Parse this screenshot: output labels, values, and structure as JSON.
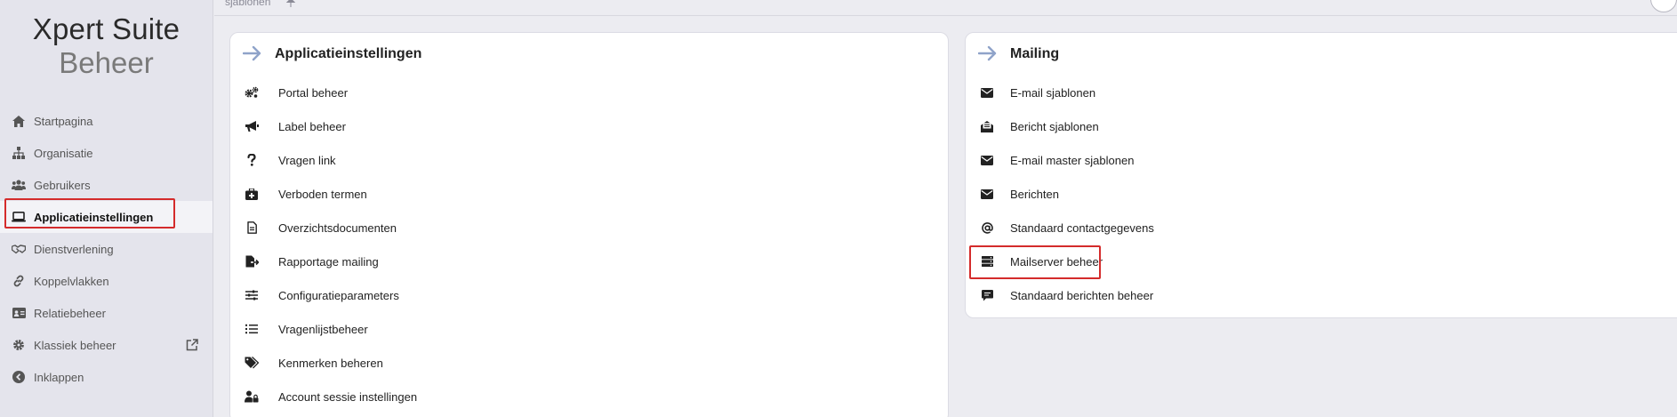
{
  "brand": {
    "line1": "Xpert Suite",
    "line2": "Beheer"
  },
  "breadcrumb": {
    "current": "sjablonen"
  },
  "sidebar": {
    "items": [
      {
        "label": "Startpagina",
        "icon": "home-icon"
      },
      {
        "label": "Organisatie",
        "icon": "sitemap-icon"
      },
      {
        "label": "Gebruikers",
        "icon": "users-icon"
      },
      {
        "label": "Applicatieinstellingen",
        "icon": "laptop-icon",
        "active": true
      },
      {
        "label": "Dienstverlening",
        "icon": "handshake-icon"
      },
      {
        "label": "Koppelvlakken",
        "icon": "link-icon"
      },
      {
        "label": "Relatiebeheer",
        "icon": "id-card-icon"
      },
      {
        "label": "Klassiek beheer",
        "icon": "gear-icon",
        "external": true
      },
      {
        "label": "Inklappen",
        "icon": "chevron-left-circle-icon"
      }
    ]
  },
  "cards": {
    "applicatie": {
      "title": "Applicatieinstellingen",
      "items": [
        {
          "label": "Portal beheer",
          "icon": "gears-icon"
        },
        {
          "label": "Label beheer",
          "icon": "megaphone-icon"
        },
        {
          "label": "Vragen link",
          "icon": "question-icon"
        },
        {
          "label": "Verboden termen",
          "icon": "first-aid-icon"
        },
        {
          "label": "Overzichtsdocumenten",
          "icon": "file-icon"
        },
        {
          "label": "Rapportage mailing",
          "icon": "file-export-icon"
        },
        {
          "label": "Configuratieparameters",
          "icon": "sliders-icon"
        },
        {
          "label": "Vragenlijstbeheer",
          "icon": "list-icon"
        },
        {
          "label": "Kenmerken beheren",
          "icon": "tags-icon"
        },
        {
          "label": "Account sessie instellingen",
          "icon": "user-lock-icon"
        }
      ]
    },
    "mailing": {
      "title": "Mailing",
      "items": [
        {
          "label": "E-mail sjablonen",
          "icon": "envelope-icon"
        },
        {
          "label": "Bericht sjablonen",
          "icon": "envelope-open-text-icon"
        },
        {
          "label": "E-mail master sjablonen",
          "icon": "envelope-icon"
        },
        {
          "label": "Berichten",
          "icon": "envelope-icon"
        },
        {
          "label": "Standaard contactgegevens",
          "icon": "at-icon"
        },
        {
          "label": "Mailserver beheer",
          "icon": "server-icon"
        },
        {
          "label": "Standaard berichten beheer",
          "icon": "comment-alt-icon"
        }
      ]
    }
  }
}
